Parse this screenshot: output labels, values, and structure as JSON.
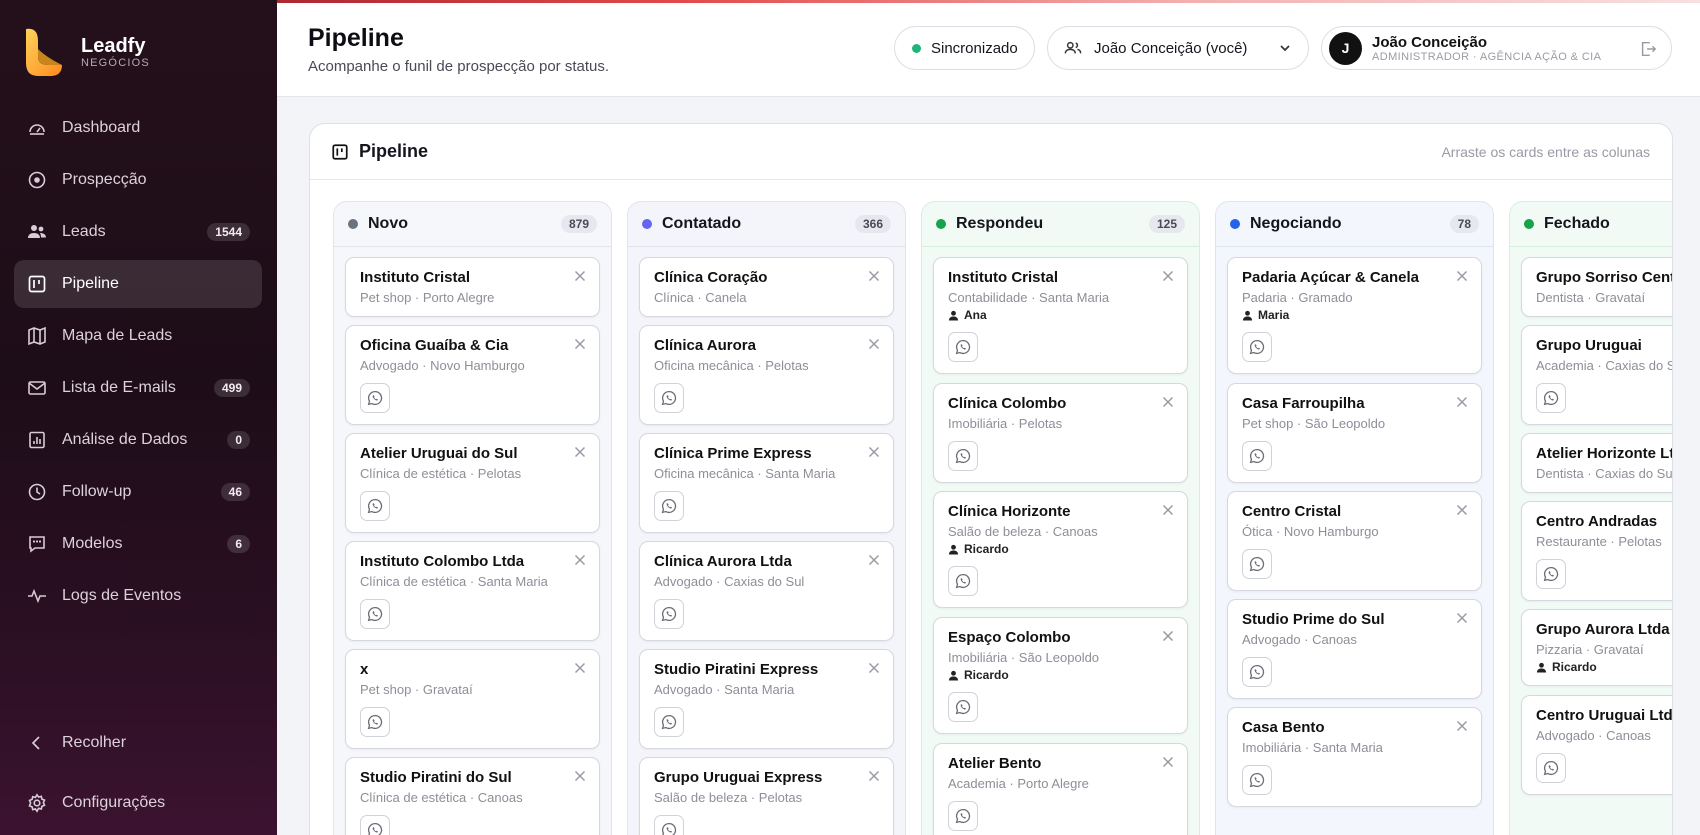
{
  "brand": {
    "name": "Leadfy",
    "sub": "NEGÓCIOS"
  },
  "nav": [
    {
      "label": "Dashboard",
      "icon": "gauge-icon",
      "badge": ""
    },
    {
      "label": "Prospecção",
      "icon": "target-icon",
      "badge": ""
    },
    {
      "label": "Leads",
      "icon": "users-icon",
      "badge": "1544"
    },
    {
      "label": "Pipeline",
      "icon": "kanban-icon",
      "badge": "",
      "active": true
    },
    {
      "label": "Mapa de Leads",
      "icon": "map-icon",
      "badge": ""
    },
    {
      "label": "Lista de E-mails",
      "icon": "mail-icon",
      "badge": "499"
    },
    {
      "label": "Análise de Dados",
      "icon": "chart-icon",
      "badge": "0"
    },
    {
      "label": "Follow-up",
      "icon": "clock-icon",
      "badge": "46"
    },
    {
      "label": "Modelos",
      "icon": "template-icon",
      "badge": "6"
    },
    {
      "label": "Logs de Eventos",
      "icon": "activity-icon",
      "badge": ""
    }
  ],
  "sidebar_footer": {
    "collapse": "Recolher",
    "settings": "Configurações"
  },
  "header": {
    "title": "Pipeline",
    "subtitle": "Acompanhe o funil de prospecção por status.",
    "sync": "Sincronizado",
    "user_select": "João Conceição (você)",
    "user_name": "João Conceição",
    "user_role": "ADMINISTRADOR · AGÊNCIA AÇÃO & CIA",
    "avatar": "J"
  },
  "board": {
    "title": "Pipeline",
    "hint": "Arraste os cards entre as colunas"
  },
  "colors": {
    "novo": "#6b7280",
    "contatado": "#6366f1",
    "respondeu": "#16a34a",
    "negociando": "#2563eb",
    "fechado": "#16a34a"
  },
  "columns": [
    {
      "name": "Novo",
      "count": "879",
      "cards": [
        {
          "title": "Instituto Cristal",
          "sub": "Pet shop · Porto Alegre",
          "owner": "",
          "wa": false
        },
        {
          "title": "Oficina Guaíba & Cia",
          "sub": "Advogado · Novo Hamburgo",
          "owner": "",
          "wa": true
        },
        {
          "title": "Atelier Uruguai do Sul",
          "sub": "Clínica de estética · Pelotas",
          "owner": "",
          "wa": true
        },
        {
          "title": "Instituto Colombo Ltda",
          "sub": "Clínica de estética · Santa Maria",
          "owner": "",
          "wa": true
        },
        {
          "title": "x",
          "sub": "Pet shop · Gravataí",
          "owner": "",
          "wa": true
        },
        {
          "title": "Studio Piratini do Sul",
          "sub": "Clínica de estética · Canoas",
          "owner": "",
          "wa": true
        }
      ]
    },
    {
      "name": "Contatado",
      "count": "366",
      "cards": [
        {
          "title": "Clínica Coração",
          "sub": "Clínica · Canela",
          "owner": "",
          "wa": false
        },
        {
          "title": "Clínica Aurora",
          "sub": "Oficina mecânica · Pelotas",
          "owner": "",
          "wa": true
        },
        {
          "title": "Clínica Prime Express",
          "sub": "Oficina mecânica · Santa Maria",
          "owner": "",
          "wa": true
        },
        {
          "title": "Clínica Aurora Ltda",
          "sub": "Advogado · Caxias do Sul",
          "owner": "",
          "wa": true
        },
        {
          "title": "Studio Piratini Express",
          "sub": "Advogado · Santa Maria",
          "owner": "",
          "wa": true
        },
        {
          "title": "Grupo Uruguai Express",
          "sub": "Salão de beleza · Pelotas",
          "owner": "",
          "wa": true
        }
      ]
    },
    {
      "name": "Respondeu",
      "count": "125",
      "cards": [
        {
          "title": "Instituto Cristal",
          "sub": "Contabilidade · Santa Maria",
          "owner": "Ana",
          "wa": true
        },
        {
          "title": "Clínica Colombo",
          "sub": "Imobiliária · Pelotas",
          "owner": "",
          "wa": true
        },
        {
          "title": "Clínica Horizonte",
          "sub": "Salão de beleza · Canoas",
          "owner": "Ricardo",
          "wa": true
        },
        {
          "title": "Espaço Colombo",
          "sub": "Imobiliária · São Leopoldo",
          "owner": "Ricardo",
          "wa": true
        },
        {
          "title": "Atelier Bento",
          "sub": "Academia · Porto Alegre",
          "owner": "",
          "wa": true
        }
      ]
    },
    {
      "name": "Negociando",
      "count": "78",
      "cards": [
        {
          "title": "Padaria Açúcar & Canela",
          "sub": "Padaria · Gramado",
          "owner": "Maria",
          "wa": true
        },
        {
          "title": "Casa Farroupilha",
          "sub": "Pet shop · São Leopoldo",
          "owner": "",
          "wa": true
        },
        {
          "title": "Centro Cristal",
          "sub": "Ótica · Novo Hamburgo",
          "owner": "",
          "wa": true
        },
        {
          "title": "Studio Prime do Sul",
          "sub": "Advogado · Canoas",
          "owner": "",
          "wa": true
        },
        {
          "title": "Casa Bento",
          "sub": "Imobiliária · Santa Maria",
          "owner": "",
          "wa": true
        }
      ]
    },
    {
      "name": "Fechado",
      "count": "",
      "cards": [
        {
          "title": "Grupo Sorriso Centro",
          "sub": "Dentista · Gravataí",
          "owner": "",
          "wa": false
        },
        {
          "title": "Grupo Uruguai",
          "sub": "Academia · Caxias do Sul",
          "owner": "",
          "wa": true
        },
        {
          "title": "Atelier Horizonte Ltda",
          "sub": "Dentista · Caxias do Sul",
          "owner": "",
          "wa": false
        },
        {
          "title": "Centro Andradas",
          "sub": "Restaurante · Pelotas",
          "owner": "",
          "wa": true
        },
        {
          "title": "Grupo Aurora Ltda",
          "sub": "Pizzaria · Gravataí",
          "owner": "Ricardo",
          "wa": false
        },
        {
          "title": "Centro Uruguai Ltda",
          "sub": "Advogado · Canoas",
          "owner": "",
          "wa": true
        }
      ]
    }
  ]
}
